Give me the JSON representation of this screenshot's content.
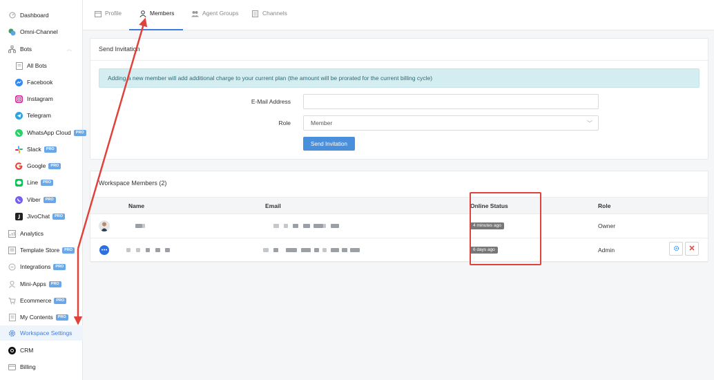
{
  "sidebar": {
    "items": [
      {
        "label": "Dashboard",
        "icon": "dashboard-icon",
        "pro": false
      },
      {
        "label": "Omni-Channel",
        "icon": "omni-channel-icon",
        "pro": false
      },
      {
        "label": "Bots",
        "icon": "bots-icon",
        "pro": false
      },
      {
        "label": "All Bots",
        "icon": "all-bots-icon",
        "pro": false
      },
      {
        "label": "Facebook",
        "icon": "facebook-icon",
        "pro": false
      },
      {
        "label": "Instagram",
        "icon": "instagram-icon",
        "pro": false
      },
      {
        "label": "Telegram",
        "icon": "telegram-icon",
        "pro": false
      },
      {
        "label": "WhatsApp Cloud",
        "icon": "whatsapp-icon",
        "pro": true
      },
      {
        "label": "Slack",
        "icon": "slack-icon",
        "pro": true
      },
      {
        "label": "Google",
        "icon": "google-icon",
        "pro": true
      },
      {
        "label": "Line",
        "icon": "line-icon",
        "pro": true
      },
      {
        "label": "Viber",
        "icon": "viber-icon",
        "pro": true
      },
      {
        "label": "JivoChat",
        "icon": "jivochat-icon",
        "pro": true
      },
      {
        "label": "Analytics",
        "icon": "analytics-icon",
        "pro": false
      },
      {
        "label": "Template Store",
        "icon": "template-store-icon",
        "pro": true
      },
      {
        "label": "Integrations",
        "icon": "integrations-icon",
        "pro": true
      },
      {
        "label": "Mini-Apps",
        "icon": "mini-apps-icon",
        "pro": true
      },
      {
        "label": "Ecommerce",
        "icon": "ecommerce-icon",
        "pro": true
      },
      {
        "label": "My Contents",
        "icon": "my-contents-icon",
        "pro": true
      },
      {
        "label": "Workspace Settings",
        "icon": "workspace-settings-icon",
        "pro": false
      },
      {
        "label": "CRM",
        "icon": "crm-icon",
        "pro": false
      },
      {
        "label": "Billing",
        "icon": "billing-icon",
        "pro": false
      }
    ],
    "pro_label": "PRO",
    "active_color": "#3d7be0"
  },
  "tabs": [
    {
      "label": "Profile",
      "icon": "calendar-icon"
    },
    {
      "label": "Members",
      "icon": "user-icon"
    },
    {
      "label": "Agent Groups",
      "icon": "users-icon"
    },
    {
      "label": "Channels",
      "icon": "document-icon"
    }
  ],
  "invite": {
    "title": "Send Invitation",
    "alert": "Adding a new member will add additional charge to your current plan (the amount will be prorated for the current billing cycle)",
    "email_label": "E-Mail Address",
    "email_value": "",
    "role_label": "Role",
    "role_value": "Member",
    "submit_label": "Send Invitation"
  },
  "members": {
    "title": "Workspace Members (2)",
    "columns": [
      "Name",
      "Email",
      "Online Status",
      "Role"
    ],
    "rows": [
      {
        "status": "4 minutes ago",
        "role": "Owner"
      },
      {
        "status": "6 days ago",
        "role": "Admin"
      }
    ]
  },
  "colors": {
    "primary": "#4a8fdc",
    "alert_bg": "#d4edf1",
    "annotation": "#e0413b",
    "danger": "#d9534f"
  }
}
